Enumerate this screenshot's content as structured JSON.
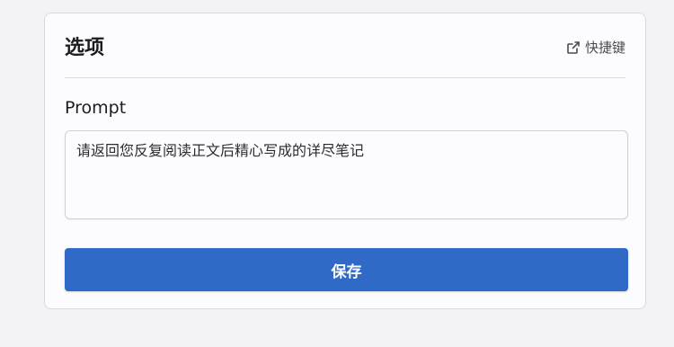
{
  "card": {
    "title": "选项",
    "shortcut_label": "快捷键",
    "shortcut_icon": "external-link-icon"
  },
  "prompt": {
    "label": "Prompt",
    "value": "请返回您反复阅读正文后精心写成的详尽笔记"
  },
  "actions": {
    "save_label": "保存"
  },
  "colors": {
    "accent": "#2f6bc6",
    "background": "#f3f3f6",
    "card": "#fcfcfe"
  }
}
